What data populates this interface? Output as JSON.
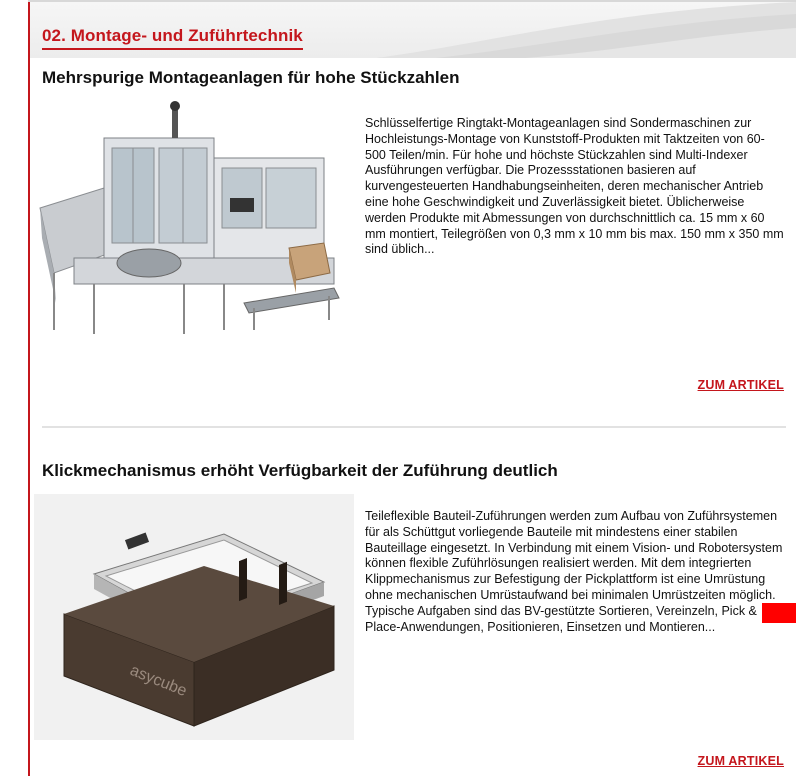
{
  "section": {
    "title": "02. Montage- und Zuführtechnik"
  },
  "articles": [
    {
      "title": "Mehrspurige Montageanlagen für hohe Stückzahlen",
      "text": "Schlüsselfertige Ringtakt-Montageanlagen sind Sondermaschinen zur Hochleistungs-Montage von Kunststoff-Produkten mit Taktzeiten von 60-500 Teilen/min. Für hohe und höchste Stückzahlen sind Multi-Indexer Ausführungen verfügbar. Die Prozessstationen basieren auf kurvengesteuerten Handhabungseinheiten, deren mechanischer Antrieb eine hohe Geschwindigkeit und Zuverlässigkeit bietet. Üblicherweise werden Produkte mit Abmessungen von durchschnittlich ca. 15 mm x 60 mm montiert, Teilegrößen von 0,3 mm x 10 mm bis max. 150 mm x 350 mm sind üblich...",
      "link": "ZUM ARTIKEL"
    },
    {
      "title": "Klickmechanismus erhöht Verfügbarkeit der Zuführung deutlich",
      "text": "Teileflexible Bauteil-Zuführungen werden zum Aufbau von Zuführsystemen für als Schüttgut vorliegende Bauteile mit mindestens einer stabilen Bauteillage eingesetzt. In Verbindung mit einem Vision- und Robotersystem können flexible Zuführlösungen realisiert werden. Mit dem integrierten Klippmechanismus zur Befestigung der Pickplattform ist eine Umrüstung ohne mechanischen Umrüstaufwand bei minimalen Umrüstzeiten möglich. Typische Aufgaben sind das BV-gestützte Sortieren, Vereinzeln, Pick & Place-Anwendungen, Positionieren, Einsetzen und Montieren...",
      "link": "ZUM ARTIKEL",
      "product_logo": "asycube"
    }
  ]
}
